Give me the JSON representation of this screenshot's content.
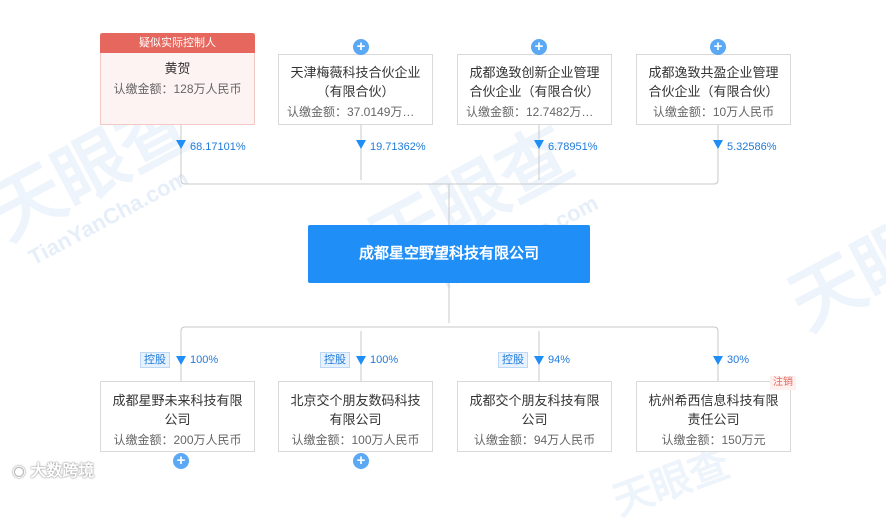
{
  "watermark": {
    "text": "天眼查",
    "sub": "TianYanCha.com"
  },
  "top": [
    {
      "tag": "疑似实际控制人",
      "name": "黄贺",
      "capital": "认缴金额：128万人民币",
      "pct": "68.17101%"
    },
    {
      "name": "天津梅薇科技合伙企业（有限合伙）",
      "capital": "认缴金额：37.0149万人...",
      "pct": "19.71362%"
    },
    {
      "name": "成都逸致创新企业管理合伙企业（有限合伙）",
      "capital": "认缴金额：12.7482万人...",
      "pct": "6.78951%"
    },
    {
      "name": "成都逸致共盈企业管理合伙企业（有限合伙）",
      "capital": "认缴金额：10万人民币",
      "pct": "5.32586%"
    }
  ],
  "center": {
    "name": "成都星空野望科技有限公司"
  },
  "bottom": [
    {
      "badge": "控股",
      "pct": "100%",
      "name": "成都星野未来科技有限公司",
      "capital": "认缴金额：200万人民币"
    },
    {
      "badge": "控股",
      "pct": "100%",
      "name": "北京交个朋友数码科技有限公司",
      "capital": "认缴金额：100万人民币"
    },
    {
      "badge": "控股",
      "pct": "94%",
      "name": "成都交个朋友科技有限公司",
      "capital": "认缴金额：94万人民币"
    },
    {
      "badge": "",
      "status": "注销",
      "pct": "30%",
      "name": "杭州希西信息科技有限责任公司",
      "capital": "认缴金额：150万元"
    }
  ],
  "logo": "大数跨境",
  "colors": {
    "accent": "#1f8ef7",
    "control_tag": "#e5675e"
  }
}
